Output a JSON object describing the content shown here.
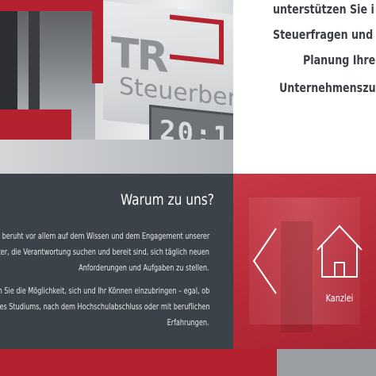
{
  "intro": {
    "lines": [
      "unterstützen Sie i",
      "Steuerfragen und",
      "Planung Ihre",
      "Unternehmenszu"
    ]
  },
  "photo": {
    "logo_letters": "TR",
    "logo_word": "Steuerbera",
    "display_digits": "20:1"
  },
  "why": {
    "title": "Warum zu uns?",
    "paragraph1": [
      "olg beruht vor allem auf dem Wissen und dem Engagement unserer",
      "beiter, die Verantwortung suchen und bereit sind, sich täglich neuen",
      "Anforderungen und Aufgaben zu stellen."
    ],
    "paragraph2": [
      "en Sie die Möglichkeit, sich und Ihr Können einzubringen – egal, ob",
      "des Studiums, nach dem Hochschulabschluss oder mit beruflichen",
      "Erfahrungen."
    ]
  },
  "nav": {
    "home_label": "Kanzlei",
    "prev_icon": "chevron-left-icon",
    "home_icon": "house-icon"
  },
  "colors": {
    "brand_red": "#b42230",
    "dark_panel": "#3c4249",
    "grey_strip": "#9a9ea3",
    "text_dark": "#3c4044"
  }
}
